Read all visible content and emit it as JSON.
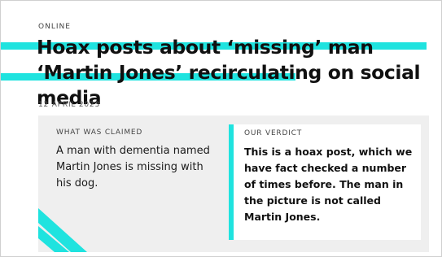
{
  "article": {
    "category": "ONLINE",
    "headline": "Hoax posts about ‘missing’ man ‘Martin Jones’ recirculating on social media",
    "date": "12 APRIL 2023"
  },
  "claim": {
    "label": "WHAT WAS CLAIMED",
    "text": "A man with dementia named Martin Jones is missing with his dog."
  },
  "verdict": {
    "label": "OUR VERDICT",
    "text": "This is a hoax post, which we have fact checked a number of times before. The man in the picture is not called Martin Jones."
  },
  "colors": {
    "accent": "#1fe3df",
    "panel_bg": "#efefef"
  }
}
